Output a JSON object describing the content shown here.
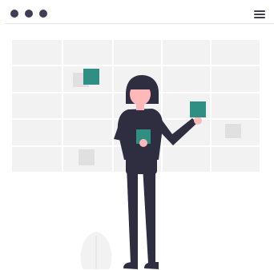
{
  "header": {
    "window_controls": [
      "dot",
      "dot",
      "dot"
    ],
    "menu_icon": "hamburger-menu-icon"
  },
  "illustration": {
    "subject": "person-holding-cards",
    "colors": {
      "accent": "#2f8f83",
      "grid_fill": "#f2f2f2",
      "grid_line": "#ffffff",
      "gray_card": "#e0e0e0",
      "dark": "#2f2e41",
      "skin": "#ffb8b8"
    }
  }
}
